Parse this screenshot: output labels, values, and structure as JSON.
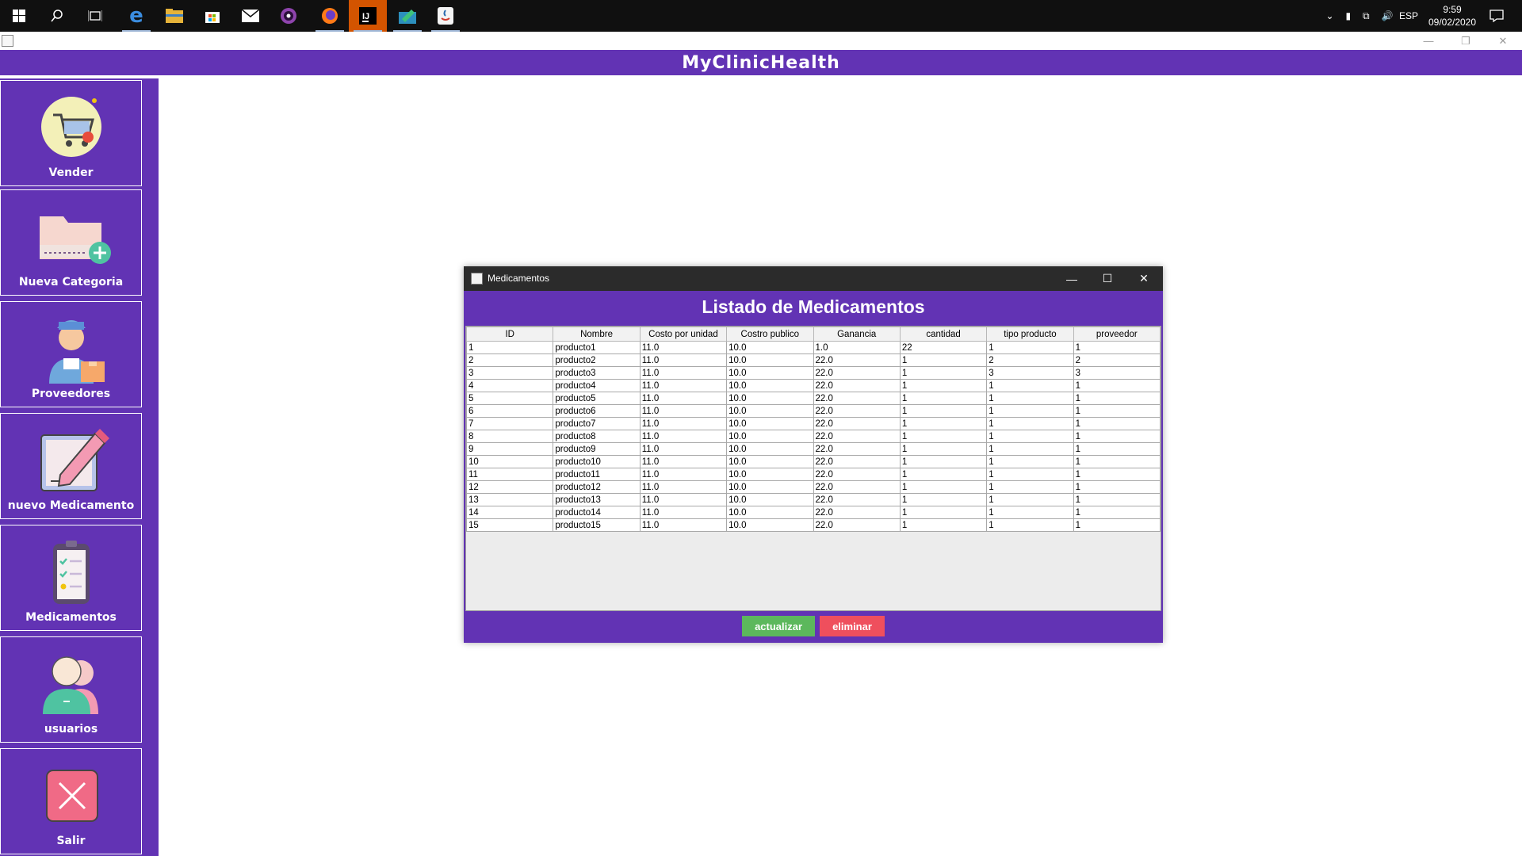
{
  "taskbar": {
    "icons": [
      {
        "name": "windows-start-icon"
      },
      {
        "name": "search-icon"
      },
      {
        "name": "task-view-icon"
      },
      {
        "name": "edge-browser-icon"
      },
      {
        "name": "file-explorer-icon"
      },
      {
        "name": "store-icon"
      },
      {
        "name": "mail-icon"
      },
      {
        "name": "media-app-icon"
      },
      {
        "name": "firefox-icon"
      },
      {
        "name": "intellij-icon"
      },
      {
        "name": "editor-app-icon"
      },
      {
        "name": "java-app-icon"
      }
    ],
    "language": "ESP",
    "time": "9:59",
    "date": "09/02/2020"
  },
  "app": {
    "title": "MyClinicHealth",
    "accent": "#6233b4"
  },
  "sidebar": {
    "items": [
      {
        "label": "Vender",
        "icon": "shopping-cart-icon"
      },
      {
        "label": "Nueva Categoria",
        "icon": "folder-add-icon"
      },
      {
        "label": "Proveedores",
        "icon": "delivery-person-icon"
      },
      {
        "label": "nuevo Medicamento",
        "icon": "edit-document-icon"
      },
      {
        "label": "Medicamentos",
        "icon": "checklist-clipboard-icon"
      },
      {
        "label": "usuarios",
        "icon": "users-icon"
      },
      {
        "label": "Salir",
        "icon": "exit-icon"
      }
    ]
  },
  "dialog": {
    "window_title": "Medicamentos",
    "heading": "Listado de Medicamentos",
    "columns": [
      "ID",
      "Nombre",
      "Costo por unidad",
      "Costro publico",
      "Ganancia",
      "cantidad",
      "tipo producto",
      "proveedor"
    ],
    "rows": [
      [
        "1",
        "producto1",
        "11.0",
        "10.0",
        "1.0",
        "22",
        "1",
        "1"
      ],
      [
        "2",
        "producto2",
        "11.0",
        "10.0",
        "22.0",
        "1",
        "2",
        "2"
      ],
      [
        "3",
        "producto3",
        "11.0",
        "10.0",
        "22.0",
        "1",
        "3",
        "3"
      ],
      [
        "4",
        "producto4",
        "11.0",
        "10.0",
        "22.0",
        "1",
        "1",
        "1"
      ],
      [
        "5",
        "producto5",
        "11.0",
        "10.0",
        "22.0",
        "1",
        "1",
        "1"
      ],
      [
        "6",
        "producto6",
        "11.0",
        "10.0",
        "22.0",
        "1",
        "1",
        "1"
      ],
      [
        "7",
        "producto7",
        "11.0",
        "10.0",
        "22.0",
        "1",
        "1",
        "1"
      ],
      [
        "8",
        "producto8",
        "11.0",
        "10.0",
        "22.0",
        "1",
        "1",
        "1"
      ],
      [
        "9",
        "producto9",
        "11.0",
        "10.0",
        "22.0",
        "1",
        "1",
        "1"
      ],
      [
        "10",
        "producto10",
        "11.0",
        "10.0",
        "22.0",
        "1",
        "1",
        "1"
      ],
      [
        "11",
        "producto11",
        "11.0",
        "10.0",
        "22.0",
        "1",
        "1",
        "1"
      ],
      [
        "12",
        "producto12",
        "11.0",
        "10.0",
        "22.0",
        "1",
        "1",
        "1"
      ],
      [
        "13",
        "producto13",
        "11.0",
        "10.0",
        "22.0",
        "1",
        "1",
        "1"
      ],
      [
        "14",
        "producto14",
        "11.0",
        "10.0",
        "22.0",
        "1",
        "1",
        "1"
      ],
      [
        "15",
        "producto15",
        "11.0",
        "10.0",
        "22.0",
        "1",
        "1",
        "1"
      ]
    ],
    "buttons": {
      "update_label": "actualizar",
      "update_color": "#5cb85c",
      "delete_label": "eliminar",
      "delete_color": "#ef4f5d"
    }
  }
}
